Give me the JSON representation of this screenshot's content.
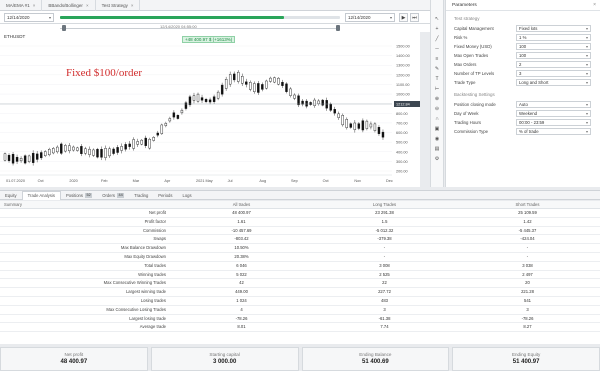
{
  "tabs": [
    {
      "label": "MA/EMA #1"
    },
    {
      "label": "BBands/Bollinger"
    },
    {
      "label": "Test Strategy"
    }
  ],
  "daterow": {
    "from": "12/14/2020",
    "to": "12/14/2020",
    "slider_label": "12/14/2020 04:55:00",
    "progress": 0.8
  },
  "chart": {
    "symbol": "ETHUSDT",
    "pl_badge": "+48 400.97 $ (+1613%)",
    "annotation": "Fixed $100/order",
    "y_ticks": [
      "1500.00",
      "1400.00",
      "1300.00",
      "1200.00",
      "1100.00",
      "1000.00",
      "900.00",
      "800.00",
      "700.00",
      "600.00",
      "500.00",
      "400.00",
      "300.00",
      "200.00"
    ],
    "x_ticks": [
      "01.07.2020",
      "Oct",
      "2020",
      "Feb",
      "Mar",
      "Apr",
      "2021 May",
      "Jul",
      "Aug",
      "Sep",
      "Oct",
      "Nov",
      "Dec"
    ],
    "last_price": "1212.84"
  },
  "panel": {
    "title": "Parameters",
    "strategy_section": "Test strategy",
    "rows": [
      {
        "label": "Capital Management",
        "value": "Fixed lots"
      },
      {
        "label": "Risk %",
        "value": "1 %"
      },
      {
        "label": "Fixed Money (USD)",
        "value": "100"
      },
      {
        "label": "Max Open Trades",
        "value": "100"
      },
      {
        "label": "Max Orders",
        "value": "2"
      },
      {
        "label": "Number of TP Levels",
        "value": "3"
      },
      {
        "label": "Trade Type",
        "value": "Long and Short"
      }
    ],
    "section2": "Backtesting Settings",
    "rows2": [
      {
        "label": "Position closing mode",
        "value": "Auto"
      },
      {
        "label": "Day of Week",
        "value": "Weekend"
      },
      {
        "label": "Trading Hours",
        "value": "00:00 - 23:59"
      },
      {
        "label": "Commission Type",
        "value": "% of trade"
      }
    ]
  },
  "bottom_tabs": [
    {
      "label": "Equity",
      "count": ""
    },
    {
      "label": "Trade Analysis",
      "count": ""
    },
    {
      "label": "Positions",
      "count": "52"
    },
    {
      "label": "Orders",
      "count": "44"
    },
    {
      "label": "Trading",
      "count": ""
    },
    {
      "label": "Periods",
      "count": ""
    },
    {
      "label": "Logs",
      "count": ""
    }
  ],
  "table": {
    "headers": [
      "Summary",
      "All trades",
      "Long Trades",
      "Short Trades"
    ],
    "rows": [
      [
        "Net profit",
        "48 400.97",
        "23 291.38",
        "25 109.59"
      ],
      [
        "Profit factor",
        "1.61",
        "1.5",
        "1.42"
      ],
      [
        "Commission",
        "-10 457.69",
        "-5 012.32",
        "-5 445.37"
      ],
      [
        "Swaps",
        "-803.42",
        "-379.38",
        "-424.04"
      ],
      [
        "Max Balance Drawdown",
        "10.50%",
        "-",
        "-"
      ],
      [
        "Max Equity Drawdown",
        "20.38%",
        "-",
        "-"
      ],
      [
        "Total trades",
        "6 046",
        "3 008",
        "3 038"
      ],
      [
        "Winning trades",
        "5 022",
        "2 525",
        "2 497"
      ],
      [
        "Max Consecutive Winning Trades",
        "42",
        "22",
        "20"
      ],
      [
        "Largest winning trade",
        "449.00",
        "227.72",
        "221.28"
      ],
      [
        "Losing trades",
        "1 024",
        "483",
        "541"
      ],
      [
        "Max Consecutive Losing Trades",
        "4",
        "3",
        "3"
      ],
      [
        "Largest losing trade",
        "-78.26",
        "-61.38",
        "-78.26"
      ],
      [
        "Average trade",
        "8.01",
        "7.74",
        "8.27"
      ]
    ]
  },
  "cards": [
    {
      "label": "Net profit",
      "value": "48 400.97"
    },
    {
      "label": "Starting capital",
      "value": "3 000.00"
    },
    {
      "label": "Ending Balance",
      "value": "51 400.69"
    },
    {
      "label": "Ending Equity",
      "value": "51 400.97"
    }
  ]
}
